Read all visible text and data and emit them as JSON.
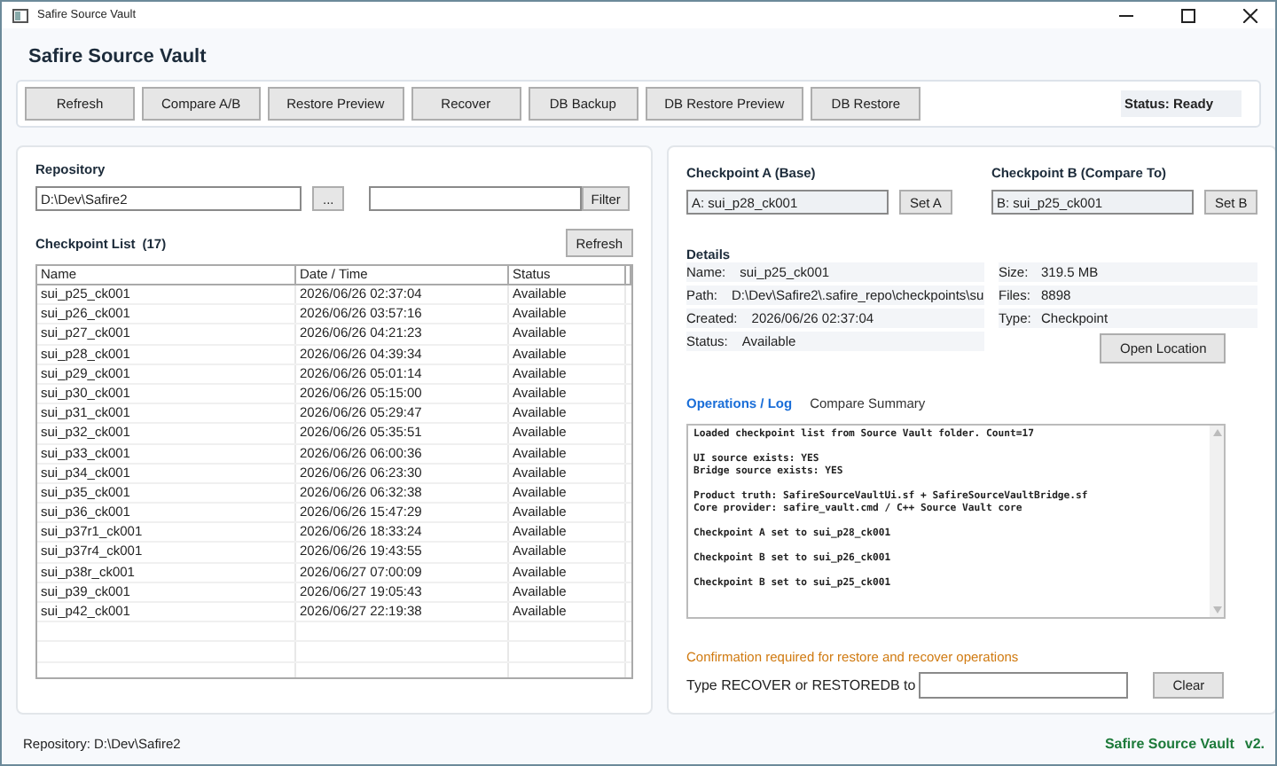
{
  "window": {
    "title": "Safire Source Vault"
  },
  "app_title": "Safire Source Vault",
  "toolbar": {
    "buttons": [
      "Refresh",
      "Compare A/B",
      "Restore Preview",
      "Recover",
      "DB Backup",
      "DB Restore Preview",
      "DB Restore"
    ],
    "status": "Status: Ready"
  },
  "repository": {
    "label": "Repository",
    "path": "D:\\Dev\\Safire2",
    "browse": "...",
    "filter_button": "Filter"
  },
  "checkpoint_list": {
    "title": "Checkpoint List",
    "count": "(17)",
    "refresh": "Refresh",
    "columns": [
      "Name",
      "Date / Time",
      "Status"
    ],
    "rows": [
      {
        "name": "sui_p25_ck001",
        "date": "2026/06/26 02:37:04",
        "status": "Available"
      },
      {
        "name": "sui_p26_ck001",
        "date": "2026/06/26 03:57:16",
        "status": "Available"
      },
      {
        "name": "sui_p27_ck001",
        "date": "2026/06/26 04:21:23",
        "status": "Available"
      },
      {
        "name": "sui_p28_ck001",
        "date": "2026/06/26 04:39:34",
        "status": "Available"
      },
      {
        "name": "sui_p29_ck001",
        "date": "2026/06/26 05:01:14",
        "status": "Available"
      },
      {
        "name": "sui_p30_ck001",
        "date": "2026/06/26 05:15:00",
        "status": "Available"
      },
      {
        "name": "sui_p31_ck001",
        "date": "2026/06/26 05:29:47",
        "status": "Available"
      },
      {
        "name": "sui_p32_ck001",
        "date": "2026/06/26 05:35:51",
        "status": "Available"
      },
      {
        "name": "sui_p33_ck001",
        "date": "2026/06/26 06:00:36",
        "status": "Available"
      },
      {
        "name": "sui_p34_ck001",
        "date": "2026/06/26 06:23:30",
        "status": "Available"
      },
      {
        "name": "sui_p35_ck001",
        "date": "2026/06/26 06:32:38",
        "status": "Available"
      },
      {
        "name": "sui_p36_ck001",
        "date": "2026/06/26 15:47:29",
        "status": "Available"
      },
      {
        "name": "sui_p37r1_ck001",
        "date": "2026/06/26 18:33:24",
        "status": "Available"
      },
      {
        "name": "sui_p37r4_ck001",
        "date": "2026/06/26 19:43:55",
        "status": "Available"
      },
      {
        "name": "sui_p38r_ck001",
        "date": "2026/06/27 07:00:09",
        "status": "Available"
      },
      {
        "name": "sui_p39_ck001",
        "date": "2026/06/27 19:05:43",
        "status": "Available"
      },
      {
        "name": "sui_p42_ck001",
        "date": "2026/06/27 22:19:38",
        "status": "Available"
      }
    ]
  },
  "checkpoint_a": {
    "label": "Checkpoint A (Base)",
    "value": "A: sui_p28_ck001",
    "button": "Set A"
  },
  "checkpoint_b": {
    "label": "Checkpoint B (Compare To)",
    "value": "B: sui_p25_ck001",
    "button": "Set B"
  },
  "details": {
    "title": "Details",
    "left": [
      {
        "label": "Name:",
        "value": "sui_p25_ck001"
      },
      {
        "label": "Path:",
        "value": "D:\\Dev\\Safire2\\.safire_repo\\checkpoints\\su"
      },
      {
        "label": "Created:",
        "value": "2026/06/26 02:37:04"
      },
      {
        "label": "Status:",
        "value": "Available"
      }
    ],
    "right": [
      {
        "label": "Size:",
        "value": "319.5 MB"
      },
      {
        "label": "Files:",
        "value": "8898"
      },
      {
        "label": "Type:",
        "value": "Checkpoint"
      }
    ],
    "open_button": "Open Location"
  },
  "tabs": [
    {
      "label": "Operations / Log",
      "selected": true
    },
    {
      "label": "Compare Summary",
      "selected": false
    }
  ],
  "log": [
    [
      "Loaded checkpoint list from Source Vault folder. Count=17"
    ],
    [
      "UI source exists: YES",
      "Bridge source exists: YES"
    ],
    [
      "Product truth: SafireSourceVaultUi.sf + SafireSourceVaultBridge.sf",
      "Core provider: safire_vault.cmd / C++ Source Vault core"
    ],
    [
      "Checkpoint A set to sui_p28_ck001"
    ],
    [
      "Checkpoint B set to sui_p26_ck001"
    ],
    [
      "Checkpoint B set to sui_p25_ck001"
    ]
  ],
  "confirmation": {
    "warning": "Confirmation required for restore and recover operations",
    "prompt": "Type RECOVER or RESTOREDB to",
    "clear": "Clear"
  },
  "status_bar": {
    "repository": "Repository: D:\\Dev\\Safire2",
    "app": "Safire Source Vault",
    "version": "v2."
  }
}
